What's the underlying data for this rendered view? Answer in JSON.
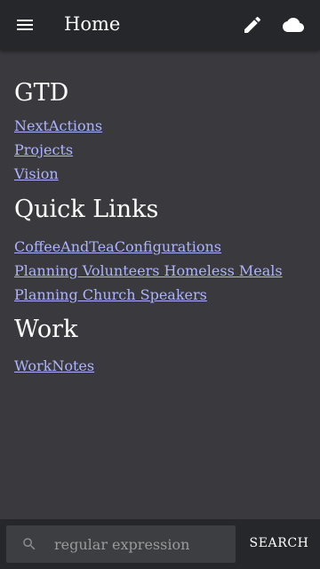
{
  "app_bar": {
    "title": "Home",
    "menu_icon": "hamburger-menu-icon",
    "edit_icon": "pencil-edit-icon",
    "sync_icon": "cloud-icon"
  },
  "sections": [
    {
      "heading": "GTD",
      "links": [
        "NextActions",
        "Projects",
        "Vision"
      ]
    },
    {
      "heading": "Quick Links",
      "links": [
        "CoffeeAndTeaConfigurations",
        "Planning Volunteers Homeless Meals",
        "Planning Church Speakers"
      ]
    },
    {
      "heading": "Work",
      "links": [
        "WorkNotes"
      ]
    }
  ],
  "search": {
    "placeholder": "regular expression",
    "value": "",
    "button_label": "SEARCH",
    "icon": "search-icon"
  },
  "colors": {
    "background": "#3a3a3e",
    "bar": "#26272a",
    "link": "#aeb3ff",
    "search_field": "#3d3e42"
  }
}
